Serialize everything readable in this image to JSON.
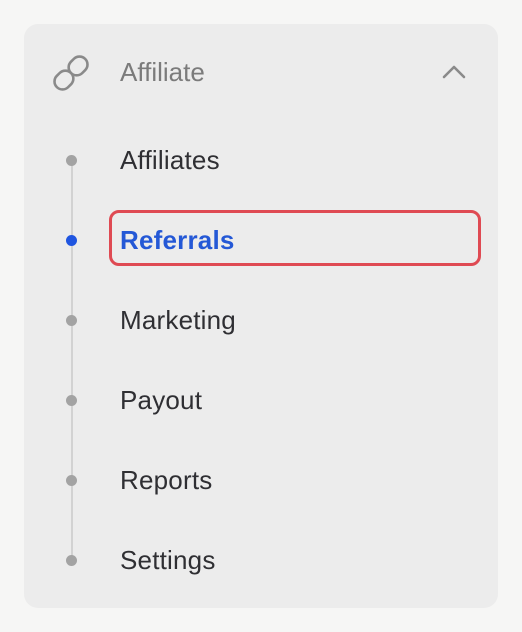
{
  "menu": {
    "group": {
      "title": "Affiliate",
      "icon": "link-icon",
      "expand_icon": "chevron-up-icon",
      "expanded": true
    },
    "items": [
      {
        "label": "Affiliates",
        "active": false
      },
      {
        "label": "Referrals",
        "active": true
      },
      {
        "label": "Marketing",
        "active": false
      },
      {
        "label": "Payout",
        "active": false
      },
      {
        "label": "Reports",
        "active": false
      },
      {
        "label": "Settings",
        "active": false
      }
    ],
    "colors": {
      "active_text": "#2458d6",
      "active_bullet": "#1f55e0",
      "highlight_border": "#df4a53",
      "inactive_text": "#2f2f33",
      "muted_text": "#7b7b7b"
    }
  }
}
